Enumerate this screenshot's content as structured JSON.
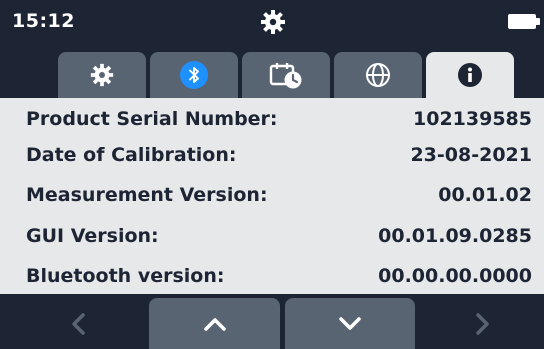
{
  "status_bar": {
    "time": "15:12",
    "center_icon": "gear-icon",
    "right_icon": "battery-icon"
  },
  "tabs": [
    {
      "icon": "gear-icon",
      "active": false
    },
    {
      "icon": "bluetooth-icon",
      "active": false
    },
    {
      "icon": "calendar-clock-icon",
      "active": false
    },
    {
      "icon": "globe-icon",
      "active": false
    },
    {
      "icon": "info-icon",
      "active": true
    }
  ],
  "info_rows": [
    {
      "label": "Product Serial Number:",
      "value": "102139585"
    },
    {
      "label": "Date of Calibration:",
      "value": "23-08-2021"
    },
    {
      "label": "Measurement Version:",
      "value": "00.01.02"
    },
    {
      "label": "GUI Version:",
      "value": "00.01.09.0285"
    },
    {
      "label": "Bluetooth version:",
      "value": "00.00.00.0000"
    }
  ],
  "bottom_nav": [
    {
      "icon": "chevron-left-icon"
    },
    {
      "icon": "chevron-up-icon"
    },
    {
      "icon": "chevron-down-icon"
    },
    {
      "icon": "chevron-right-icon"
    }
  ],
  "colors": {
    "dark_bar": "#1d2433",
    "tab_inactive": "#596472",
    "content_bg": "#e7e8ea",
    "bluetooth_accent": "#1e90ff",
    "text": "#1d2433"
  }
}
